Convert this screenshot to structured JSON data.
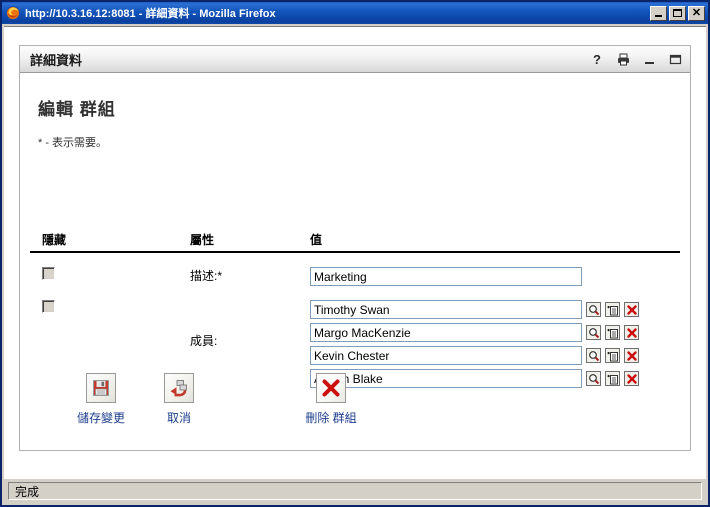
{
  "window": {
    "title": "http://10.3.16.12:8081 - 詳細資料 - Mozilla Firefox",
    "icon": "firefox-icon",
    "buttons": {
      "minimize": "_",
      "maximize": "□",
      "close": "✕"
    }
  },
  "statusbar": {
    "text": "完成"
  },
  "panel": {
    "title": "詳細資料",
    "tools": [
      {
        "name": "help-icon",
        "glyph": "?"
      },
      {
        "name": "print-icon",
        "glyph": ""
      },
      {
        "name": "minimize-icon",
        "glyph": ""
      },
      {
        "name": "maximize-icon",
        "glyph": ""
      }
    ]
  },
  "form": {
    "heading": "編輯 群組",
    "required_note": "* - 表示需要。",
    "columns": {
      "hide": "隱藏",
      "attribute": "屬性",
      "value": "值"
    },
    "rows": [
      {
        "name": "description-row",
        "label": "描述:*",
        "checkbox_checked": false,
        "value": "Marketing"
      },
      {
        "name": "members-row",
        "label": "成員:",
        "checkbox_checked": false,
        "members": [
          "Timothy Swan",
          "Margo MacKenzie",
          "Kevin Chester",
          "Allison Blake"
        ]
      }
    ],
    "row_icons": [
      {
        "name": "lookup-icon",
        "title": "lookup"
      },
      {
        "name": "add-entry-icon",
        "title": "add"
      },
      {
        "name": "remove-icon",
        "title": "remove"
      }
    ]
  },
  "actions": [
    {
      "name": "save-changes-button",
      "icon": "save-floppy-icon",
      "label": "儲存變更"
    },
    {
      "name": "cancel-button",
      "icon": "undo-arrow-icon",
      "label": "取消"
    },
    {
      "name": "delete-group-button",
      "icon": "delete-x-icon",
      "label": "刪除 群組"
    }
  ],
  "colors": {
    "titlebar": "#0a3f9e",
    "link": "#1f3f8f",
    "input_border": "#7f9db9",
    "danger": "#cc2222"
  }
}
